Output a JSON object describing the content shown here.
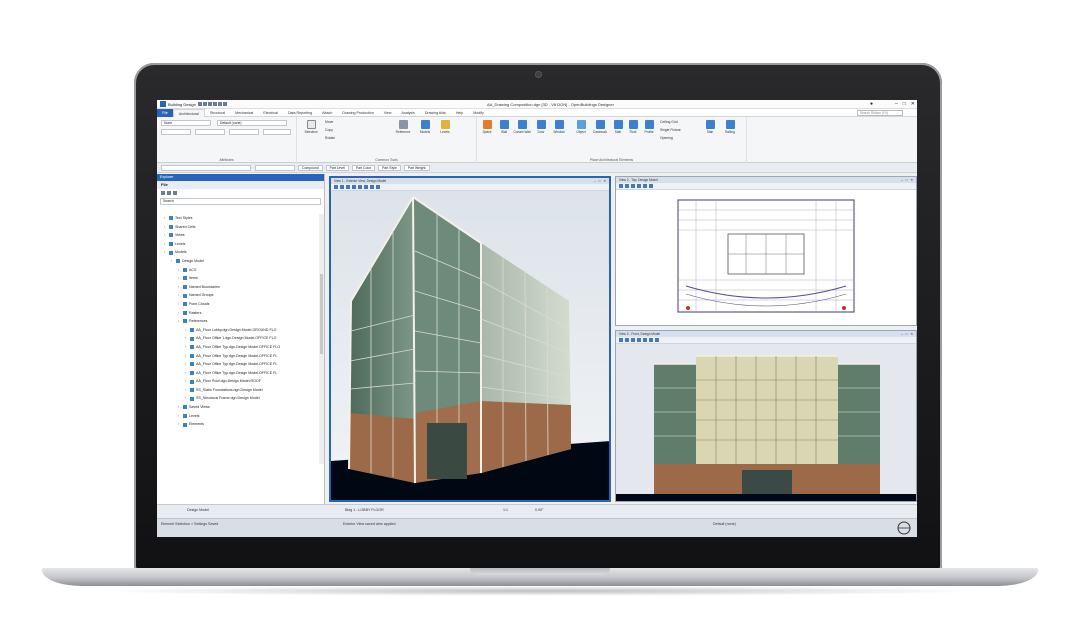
{
  "app": {
    "name": "Building Design",
    "doc_title": "AA_Drawing Composition.dgn [3D - V8 DGN] - OpenBuildings Designer"
  },
  "ribbon_tabs": [
    "File",
    "Architectural",
    "Structural",
    "Mechanical",
    "Electrical",
    "Data Reporting",
    "Attach",
    "Drawing Production",
    "View",
    "Analysis",
    "Drawing Aids",
    "Help",
    "Modify"
  ],
  "ribbon_search_placeholder": "Search Ribbon (F4)",
  "ribbon": {
    "attributes": {
      "level_value": "None",
      "style_value": "Default (none)",
      "label": "Attributes"
    },
    "common_tools": {
      "selection": "Selection",
      "move": "Move",
      "copy": "Copy",
      "rotate": "Rotate",
      "reference": "Reference",
      "models": "Models",
      "levels": "Levels",
      "label": "Common Tools"
    },
    "place_elements": {
      "space": "Space",
      "wall": "Wall",
      "curtain_wall": "Curtain Wall",
      "door": "Door",
      "window": "Window",
      "object": "Object",
      "casework": "Casework",
      "slab": "Slab",
      "roof": "Roof",
      "profile": "Profile",
      "ceiling_grid": "Ceiling Grid",
      "single_fixture": "Single Fixture",
      "opening": "Opening",
      "stair": "Stair",
      "railing": "Railing",
      "label": "Place Architectural Elements"
    }
  },
  "attribute_strip": {
    "compound": "Compound",
    "part_level": "Part Level",
    "part_color": "Part Color",
    "part_style": "Part Style",
    "part_weight": "Part Weight"
  },
  "explorer": {
    "title": "Explorer",
    "file_label": "File",
    "search_placeholder": "Search",
    "tree": [
      {
        "indent": 1,
        "label": "Text Styles"
      },
      {
        "indent": 1,
        "label": "Shared Cells"
      },
      {
        "indent": 1,
        "label": "Views"
      },
      {
        "indent": 1,
        "label": "Levels"
      },
      {
        "indent": 1,
        "label": "Models"
      },
      {
        "indent": 2,
        "label": "Design Model"
      },
      {
        "indent": 3,
        "label": "ACS"
      },
      {
        "indent": 3,
        "label": "Items"
      },
      {
        "indent": 3,
        "label": "Named Boundaries"
      },
      {
        "indent": 3,
        "label": "Named Groups"
      },
      {
        "indent": 3,
        "label": "Point Clouds"
      },
      {
        "indent": 3,
        "label": "Rasters"
      },
      {
        "indent": 3,
        "label": "References"
      },
      {
        "indent": 4,
        "label": "AA_Floor Lobby.dgn.Design Model.GROUND FLO"
      },
      {
        "indent": 4,
        "label": "AA_Floor Office 1.dgn.Design Model.OFFICE FLO"
      },
      {
        "indent": 4,
        "label": "AA_Floor Office Typ.dgn.Design Model.OFFICE FLO"
      },
      {
        "indent": 4,
        "label": "AA_Floor Office Typ.dgn.Design Model.OFFICE FL"
      },
      {
        "indent": 4,
        "label": "AA_Floor Office Typ.dgn.Design Model.OFFICE FL"
      },
      {
        "indent": 4,
        "label": "AA_Floor Office Typ.dgn.Design Model.OFFICE FL"
      },
      {
        "indent": 4,
        "label": "AA_Floor Roof.dgn.Design Model.ROOF"
      },
      {
        "indent": 4,
        "label": "SS_Slabs Foundations.dgn.Design Model"
      },
      {
        "indent": 4,
        "label": "SS_Structural Frame.dgn.Design Model"
      },
      {
        "indent": 3,
        "label": "Saved Views"
      },
      {
        "indent": 3,
        "label": "Levels"
      },
      {
        "indent": 3,
        "label": "Elements"
      }
    ],
    "panels": [
      "Items",
      "Resources",
      "Where Index",
      "eWiz"
    ]
  },
  "views": {
    "view1_title": "View 1 - Exterior View, Design Model",
    "view2_title": "View 2 - Top, Design Model",
    "view3_title": "View 3 - Front, Design Model"
  },
  "bottom_bar": {
    "model": "Design Model",
    "floor": "Bldg 1 - LOBBY FLOOR",
    "scale": "1:1",
    "angle": "0.00°"
  },
  "status": {
    "left": "Element Selection > Settings Saved",
    "middle": "Exterior View saved view applied",
    "right": "Default (none)"
  },
  "colors": {
    "accent": "#2a64b8",
    "sky": "#e9edf1",
    "ground": "#000814",
    "brick": "#9c6a48",
    "glass": "#5f7d6a"
  }
}
